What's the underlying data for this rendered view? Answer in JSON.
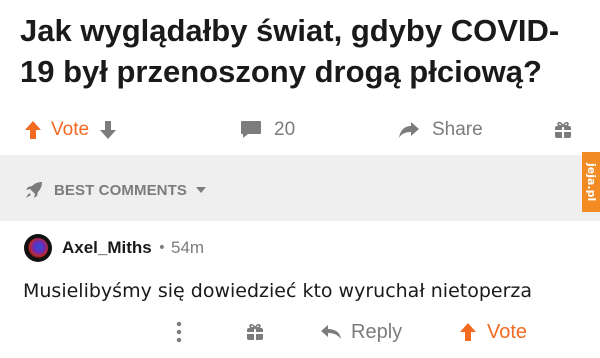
{
  "post": {
    "title": "Jak wyglądałby świat, gdyby COVID-19 był przenoszony drogą płciową?",
    "vote_label": "Vote",
    "comment_count": "20",
    "share_label": "Share"
  },
  "comments_section": {
    "sort_label": "BEST COMMENTS"
  },
  "watermark": "jeja.pl",
  "comment": {
    "username": "Axel_Miths",
    "separator": "•",
    "age": "54m",
    "body": "Musielibyśmy się dowiedzieć kto wyruchał nietoperza",
    "reply_label": "Reply",
    "vote_label": "Vote"
  },
  "colors": {
    "accent": "#f36a23",
    "muted": "#7c7c7c",
    "band": "#efefef",
    "watermark_bg": "#f38b25"
  },
  "icons": [
    "arrow-up-icon",
    "arrow-down-icon",
    "comment-icon",
    "share-icon",
    "award-icon",
    "rocket-icon",
    "chevron-down-icon",
    "more-icon",
    "reply-icon"
  ]
}
